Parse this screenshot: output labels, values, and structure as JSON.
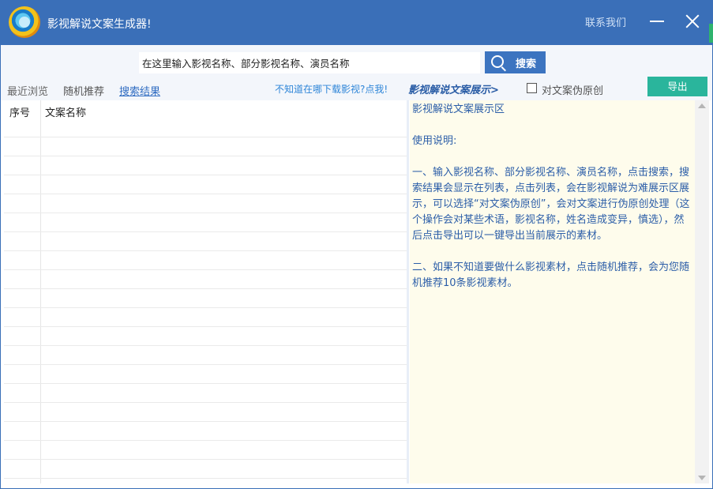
{
  "window": {
    "title": "影视解说文案生成器!",
    "contact_label": "联系我们",
    "title_bg": "#3a6fb8"
  },
  "search": {
    "value": "在这里输入影视名称、部分影视名称、演员名称",
    "button_label": "搜索"
  },
  "tabs": {
    "recent": "最近浏览",
    "random": "随机推荐",
    "results": "搜索结果"
  },
  "download_link": "不知道在哪下载影视?点我!",
  "display_heading": "影视解说文案展示>",
  "pseudo_original": {
    "label": "对文案伪原创",
    "checked": false
  },
  "export_label": "导出",
  "list": {
    "col_no": "序号",
    "col_name": "文案名称"
  },
  "display": {
    "heading": "影视解说文案展示区",
    "usage_title": "使用说明:",
    "para1": "一、输入影视名称、部分影视名称、演员名称，点击搜索，搜索结果会显示在列表，点击列表，会在影视解说为难展示区展示，可以选择“对文案伪原创”，会对文案进行伪原创处理（这个操作会对某些术语，影视名称，姓名造成变异，慎选），然后点击导出可以一键导出当前展示的素材。",
    "para2": "二、如果不知道要做什么影视素材，点击随机推荐，会为您随机推荐10条影视素材。"
  },
  "icons": {
    "app_logo": "app-logo-icon",
    "search": "search-icon",
    "minimize": "minimize-icon",
    "close": "close-icon"
  },
  "colors": {
    "accent": "#3c74c0",
    "export": "#2ab59c",
    "display_bg": "#fefcec",
    "display_text": "#2c5ea8"
  }
}
